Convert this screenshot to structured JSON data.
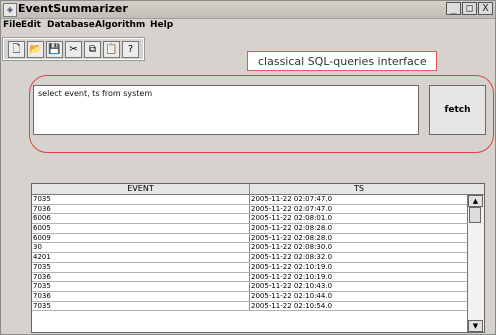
{
  "window": {
    "title": "EventSummarizer",
    "min_icon": "_",
    "max_icon": "□",
    "close_icon": "X"
  },
  "menu": [
    "File",
    "Edit",
    "Database",
    "Algorithm",
    "Help"
  ],
  "toolbar": {
    "icons": [
      "new-file-icon",
      "open-folder-icon",
      "save-icon",
      "cut-icon",
      "copy-icon",
      "paste-icon",
      "help-icon"
    ],
    "glyphs": [
      "🗋",
      "📂",
      "💾",
      "✂",
      "⧉",
      "📋",
      "?"
    ]
  },
  "mode_label": "classical SQL-queries interface",
  "query": "select event, ts  from system",
  "fetch_label": "fetch",
  "table": {
    "headers": [
      "EVENT",
      "TS"
    ],
    "rows": [
      [
        "7035",
        "2005-11-22 02:07:47.0"
      ],
      [
        "7036",
        "2005-11-22 02:07:47.0"
      ],
      [
        "6006",
        "2005-11-22 02:08:01.0"
      ],
      [
        "6005",
        "2005-11-22 02:08:28.0"
      ],
      [
        "6009",
        "2005-11-22 02:08:28.0"
      ],
      [
        "30",
        "2005-11-22 02:08:30.0"
      ],
      [
        "4201",
        "2005-11-22 02:08:32.0"
      ],
      [
        "7035",
        "2005-11-22 02:10:19.0"
      ],
      [
        "7036",
        "2005-11-22 02:10:19.0"
      ],
      [
        "7035",
        "2005-11-22 02:10:43.0"
      ],
      [
        "7036",
        "2005-11-22 02:10:44.0"
      ],
      [
        "7035",
        "2005-11-22 02:10:54.0"
      ]
    ]
  }
}
